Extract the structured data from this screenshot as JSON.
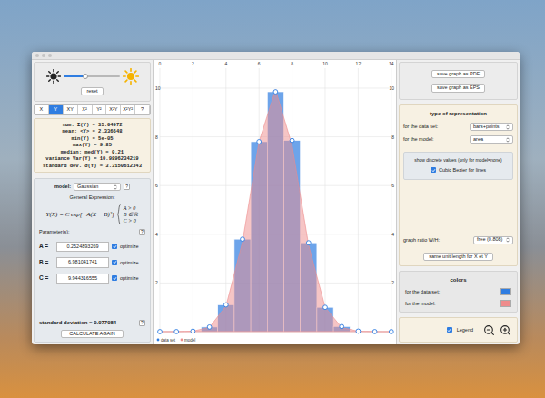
{
  "brightness": {
    "level": 0.4,
    "reset": "reset"
  },
  "tabs": [
    {
      "label": "X",
      "selected": false
    },
    {
      "label": "Y",
      "selected": true
    },
    {
      "label": "XY",
      "selected": false
    },
    {
      "label": "X²",
      "selected": false
    },
    {
      "label": "Y²",
      "selected": false
    },
    {
      "label": "X²Y",
      "selected": false
    },
    {
      "label": "X²Y²",
      "selected": false
    },
    {
      "label": "?",
      "selected": false
    }
  ],
  "stats": [
    "sum: Σ(Y) = 35.04972",
    "mean: <Y> = 2.336648",
    "min(Y) = 5e-05",
    "max(Y) = 9.85",
    "median: med(Y) = 0.21",
    "variance Var(Y) = 10.9896234219",
    "standard dev. σ(Y) = 3.3150612343"
  ],
  "model": {
    "label": "model:",
    "value": "Gaussian",
    "help": "?"
  },
  "expression": {
    "label": "General Expression:",
    "formula": "Y(X) = C exp[−A(X − B)²]",
    "conditions": [
      "A > 0",
      "B ∈ ℝ",
      "C > 0"
    ]
  },
  "parameters": {
    "label": "Parameter(s):",
    "help": "?",
    "items": [
      {
        "name": "A",
        "sign": "=",
        "value": "0.2524893269",
        "option": "optimize",
        "checked": true
      },
      {
        "name": "B",
        "sign": "=",
        "value": "6.981041741",
        "option": "optimize",
        "checked": true
      },
      {
        "name": "C",
        "sign": "=",
        "value": "9.944316555",
        "option": "optimize",
        "checked": true
      }
    ]
  },
  "std_dev": {
    "text": "standard deviation = 0.077084",
    "help": "?"
  },
  "calculate": "CALCULATE AGAIN",
  "chart": {
    "x_ticks": [
      "0",
      "2",
      "4",
      "6",
      "8",
      "10",
      "12",
      "14"
    ],
    "y_ticks": [
      "2",
      "4",
      "6",
      "8",
      "10"
    ],
    "series": [
      {
        "name": "data set",
        "color": "#2f7de1",
        "values": [
          5e-05,
          0.001,
          0.02,
          0.19,
          1.1,
          3.8,
          7.8,
          9.85,
          7.85,
          3.65,
          1.0,
          0.21,
          0.02,
          0.001,
          0.0001
        ]
      },
      {
        "name": "model",
        "color": "#ee8c8c",
        "values": [
          0.0001,
          0.0012,
          0.019,
          0.18,
          1.05,
          3.69,
          7.8,
          9.94,
          7.65,
          3.55,
          1.0,
          0.17,
          0.017,
          0.001,
          0.0001
        ]
      }
    ]
  },
  "save": [
    "save graph as PDF",
    "save graph as EPS"
  ],
  "representation": {
    "title": "type of representation",
    "data_label": "for the data set:",
    "data_value": "bars+points",
    "model_label": "for the model:",
    "model_value": "area",
    "discrete": "show discrete values (only for model=none)",
    "bezier": {
      "label": "Cubic Bezier for lines",
      "checked": true
    },
    "ratio_label": "graph ratio W/H:",
    "ratio_value": "free (0.808)",
    "unit": "same unit length for X et Y"
  },
  "colors": {
    "title": "colors",
    "items": [
      {
        "label": "for the data set:",
        "color": "#2f7de1"
      },
      {
        "label": "for the model:",
        "color": "#ee8c8c"
      }
    ]
  },
  "legend": {
    "label": "Legend",
    "checked": true
  }
}
